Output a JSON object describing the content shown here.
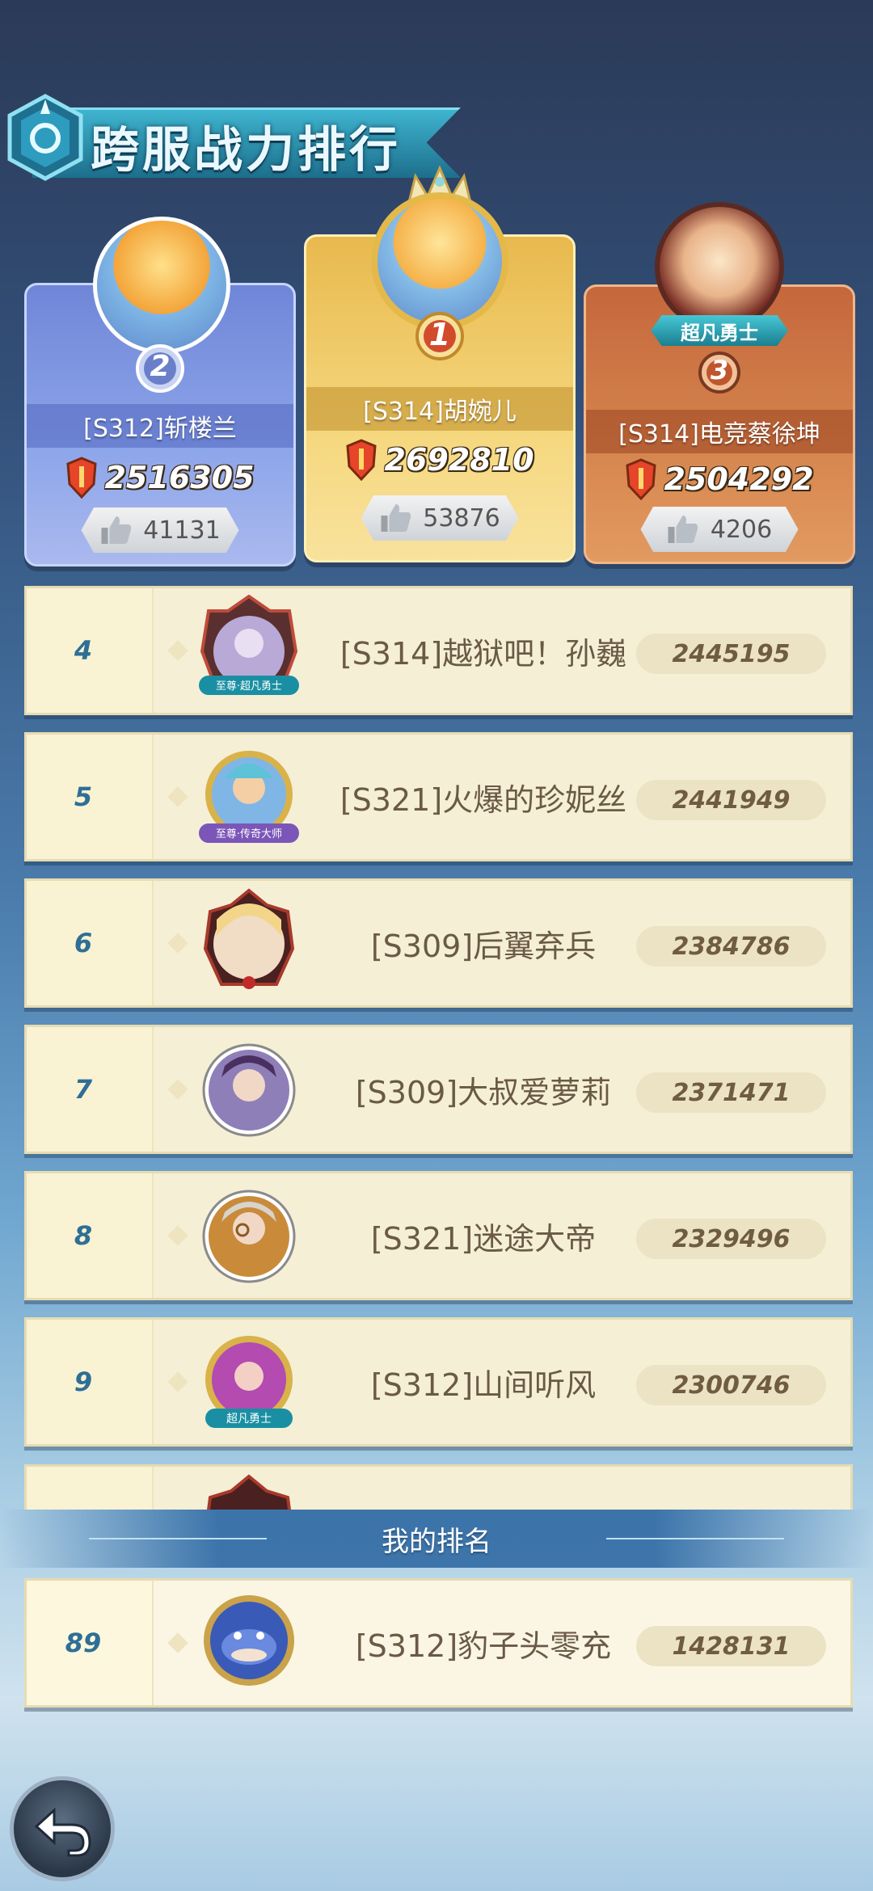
{
  "header": {
    "title": "跨服战力排行"
  },
  "podium": [
    {
      "rank": "2",
      "name": "[S312]斩楼兰",
      "power": "2516305",
      "likes": "41131"
    },
    {
      "rank": "1",
      "name": "[S314]胡婉儿",
      "power": "2692810",
      "likes": "53876"
    },
    {
      "rank": "3",
      "name": "[S314]电竞蔡徐坤",
      "power": "2504292",
      "likes": "4206",
      "title_badge": "超凡勇士"
    }
  ],
  "list": [
    {
      "rank": "4",
      "name": "[S314]越狱吧！孙巍",
      "score": "2445195",
      "badge": "至尊·超凡勇士"
    },
    {
      "rank": "5",
      "name": "[S321]火爆的珍妮丝",
      "score": "2441949",
      "badge": "至尊·传奇大师"
    },
    {
      "rank": "6",
      "name": "[S309]后翼弃兵",
      "score": "2384786"
    },
    {
      "rank": "7",
      "name": "[S309]大叔爱萝莉",
      "score": "2371471"
    },
    {
      "rank": "8",
      "name": "[S321]迷途大帝",
      "score": "2329496"
    },
    {
      "rank": "9",
      "name": "[S312]山间听风",
      "score": "2300746",
      "badge": "超凡勇士"
    }
  ],
  "my_rank": {
    "label": "我的排名",
    "rank": "89",
    "name": "[S312]豹子头零充",
    "score": "1428131"
  },
  "icons": {
    "back": "back-arrow-icon",
    "like": "thumbs-up-icon",
    "power": "shield-sword-icon"
  },
  "colors": {
    "gold": "#f5d77d",
    "silver_blue": "#8ea6ea",
    "bronze": "#d6864e",
    "rank_text": "#2e6f95"
  }
}
